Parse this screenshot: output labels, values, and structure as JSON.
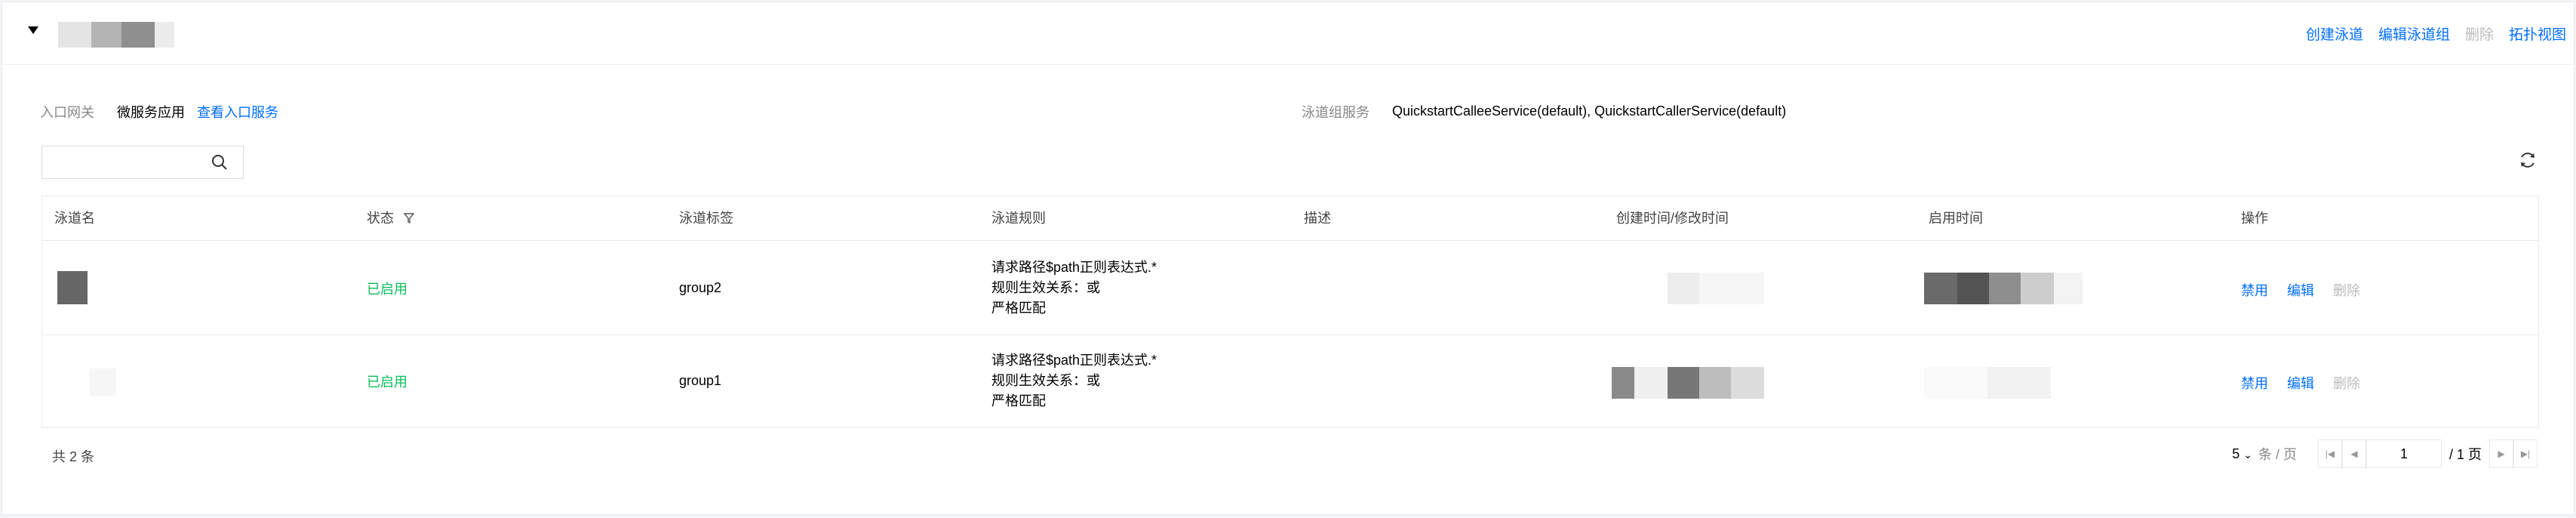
{
  "header": {
    "actions": {
      "create_lane": "创建泳道",
      "edit_lane_group": "编辑泳道组",
      "delete": "删除",
      "topology_view": "拓扑视图"
    }
  },
  "info": {
    "gateway_label": "入口网关",
    "gateway_value": "微服务应用",
    "view_gateway_link": "查看入口服务",
    "lane_group_label": "泳道组服务",
    "lane_group_value": "QuickstartCalleeService(default), QuickstartCallerService(default)"
  },
  "search": {
    "placeholder": ""
  },
  "table": {
    "columns": [
      "泳道名",
      "状态",
      "泳道标签",
      "泳道规则",
      "描述",
      "创建时间/修改时间",
      "启用时间",
      "操作"
    ],
    "rows": [
      {
        "status": "已启用",
        "tag": "group2",
        "rule": [
          "请求路径$path正则表达式.*",
          "规则生效关系：或",
          "严格匹配"
        ],
        "ops": [
          "禁用",
          "编辑",
          "删除"
        ]
      },
      {
        "status": "已启用",
        "tag": "group1",
        "rule": [
          "请求路径$path正则表达式.*",
          "规则生效关系：或",
          "严格匹配"
        ],
        "ops": [
          "禁用",
          "编辑",
          "删除"
        ]
      }
    ]
  },
  "pagination": {
    "total_text": "共 2 条",
    "page_size": "5",
    "per_page_unit": "条 / 页",
    "current_page": "1",
    "total_pages_text": "/ 1 页"
  }
}
